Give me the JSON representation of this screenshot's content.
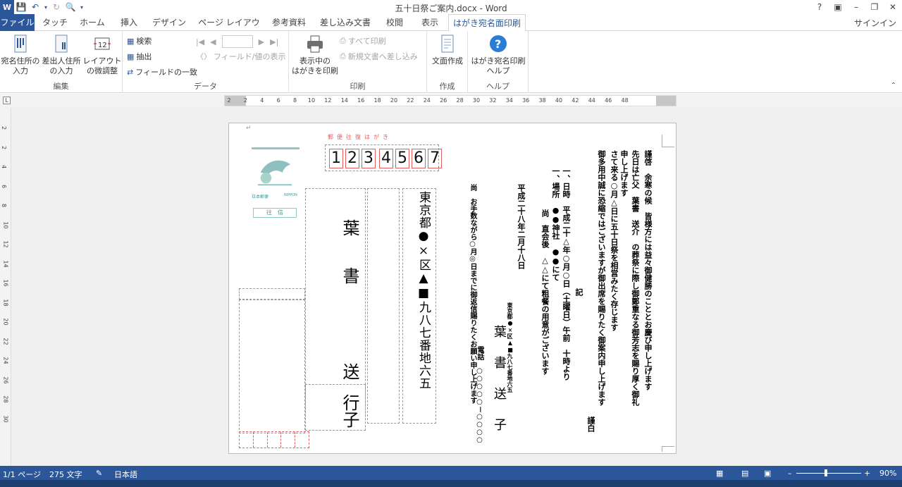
{
  "window": {
    "title": "五十日祭ご案内.docx - Word"
  },
  "qat": {
    "app_icon": "W"
  },
  "tabs": [
    "ファイル",
    "タッチ",
    "ホーム",
    "挿入",
    "デザイン",
    "ページ レイアウト",
    "参考資料",
    "差し込み文書",
    "校閲",
    "表示",
    "はがき宛名面印刷"
  ],
  "signin": "サインイン",
  "ribbon": {
    "groups": {
      "edit": "編集",
      "data": "データ",
      "print": "印刷",
      "create": "作成",
      "help": "ヘルプ"
    },
    "addr_input": "宛名住所の\n入力",
    "sender_input": "差出人住所\nの入力",
    "layout_adjust": "レイアウト\nの微調整",
    "search": "検索",
    "extract": "抽出",
    "field_match": "フィールドの一致",
    "field_value_display": "フィールド/値の表示",
    "print_all": "すべて印刷",
    "merge_new_doc": "新規文書へ差し込み",
    "print_shown": "表示中の\nはがきを印刷",
    "create_text": "文面作成",
    "help_btn": "はがき宛名印刷\nヘルプ"
  },
  "ruler": {
    "h_ticks": [
      "2",
      "2",
      "4",
      "6",
      "8",
      "10",
      "12",
      "14",
      "16",
      "18",
      "20",
      "22",
      "24",
      "26",
      "28",
      "30",
      "32",
      "34",
      "36",
      "38",
      "40",
      "42",
      "44",
      "46",
      "48"
    ],
    "v_ticks": [
      "2",
      "2",
      "4",
      "6",
      "8",
      "10",
      "12",
      "14",
      "16",
      "18",
      "20",
      "22",
      "24",
      "26",
      "28",
      "30"
    ]
  },
  "postcard": {
    "header_label": "郵便往復はがき",
    "stamp_brand": "日本郵便",
    "stamp_code": "NIPPON",
    "stamp_ou": "往　信",
    "postal_digits": [
      "1",
      "2",
      "3",
      "4",
      "5",
      "6",
      "7"
    ],
    "recipient": "葉　書　　　送　子",
    "honorific": "行",
    "address": "東京都●×区▲■九八七番地六五",
    "letter_col1": "謹啓　余寒の候　皆様方には益々御健勝のこととお慶び申し上げます",
    "letter_col2": "先日は亡父　葉書　送介　の葬祭に際し御鄭重なる御芳志を賜り厚く御礼",
    "letter_col3": "申し上げます",
    "letter_col4": "さて来る○月△日に五十日祭を相営みたく存じます",
    "letter_col5": "御多用中誠に恐縮ではございますが御出席を賜りたく御案内申し上げます",
    "letter_col6": "謹白",
    "ki": "記",
    "item1": "一、日時　平成二十△年○月○日（土曜日）午前　十時より",
    "item2": "一、場所　●●神社　●●にて",
    "item3": "尚　直会後　△△にて粗餐の用意がございます",
    "date": "平成二十八年二月十八日",
    "sender_addr": "東京都●×区▲■九八七番地六五",
    "sender_name": "葉　書　送　子",
    "sender_tel": "電話　○○○○○－○○○○",
    "note": "尚　お手数ながら○月◎日までに御返信賜りたくお願い申し上げます"
  },
  "status": {
    "page": "1/1 ページ",
    "words": "275 文字",
    "lang": "日本語",
    "zoom": "90%"
  }
}
